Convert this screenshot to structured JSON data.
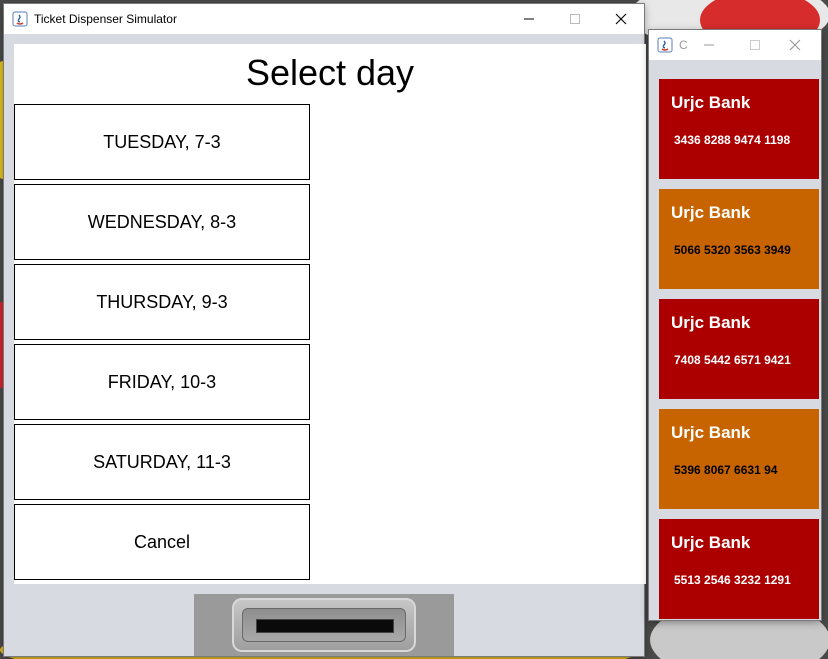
{
  "main_window": {
    "title": "Ticket Dispenser Simulator",
    "heading": "Select day",
    "day_buttons": [
      {
        "label": "TUESDAY, 7-3"
      },
      {
        "label": "WEDNESDAY, 8-3"
      },
      {
        "label": "THURSDAY, 9-3"
      },
      {
        "label": "FRIDAY, 10-3"
      },
      {
        "label": "SATURDAY, 11-3"
      }
    ],
    "cancel_label": "Cancel"
  },
  "cards_window": {
    "title": "C",
    "cards": [
      {
        "bank": "Urjc Bank",
        "number": "3436 8288 9474 1198",
        "color": "#ac0000",
        "number_color": "#ffffff"
      },
      {
        "bank": "Urjc Bank",
        "number": "5066 5320 3563 3949",
        "color": "#c86400",
        "number_color": "#000000"
      },
      {
        "bank": "Urjc Bank",
        "number": "7408 5442 6571 9421",
        "color": "#ac0000",
        "number_color": "#ffffff"
      },
      {
        "bank": "Urjc Bank",
        "number": "5396 8067 6631 94",
        "color": "#c86400",
        "number_color": "#000000"
      },
      {
        "bank": "Urjc Bank",
        "number": "5513 2546 3232 1291",
        "color": "#ac0000",
        "number_color": "#ffffff"
      }
    ]
  },
  "icons": {
    "app": "java-icon",
    "minimize": "minimize-icon",
    "maximize": "maximize-icon",
    "close": "close-icon"
  }
}
